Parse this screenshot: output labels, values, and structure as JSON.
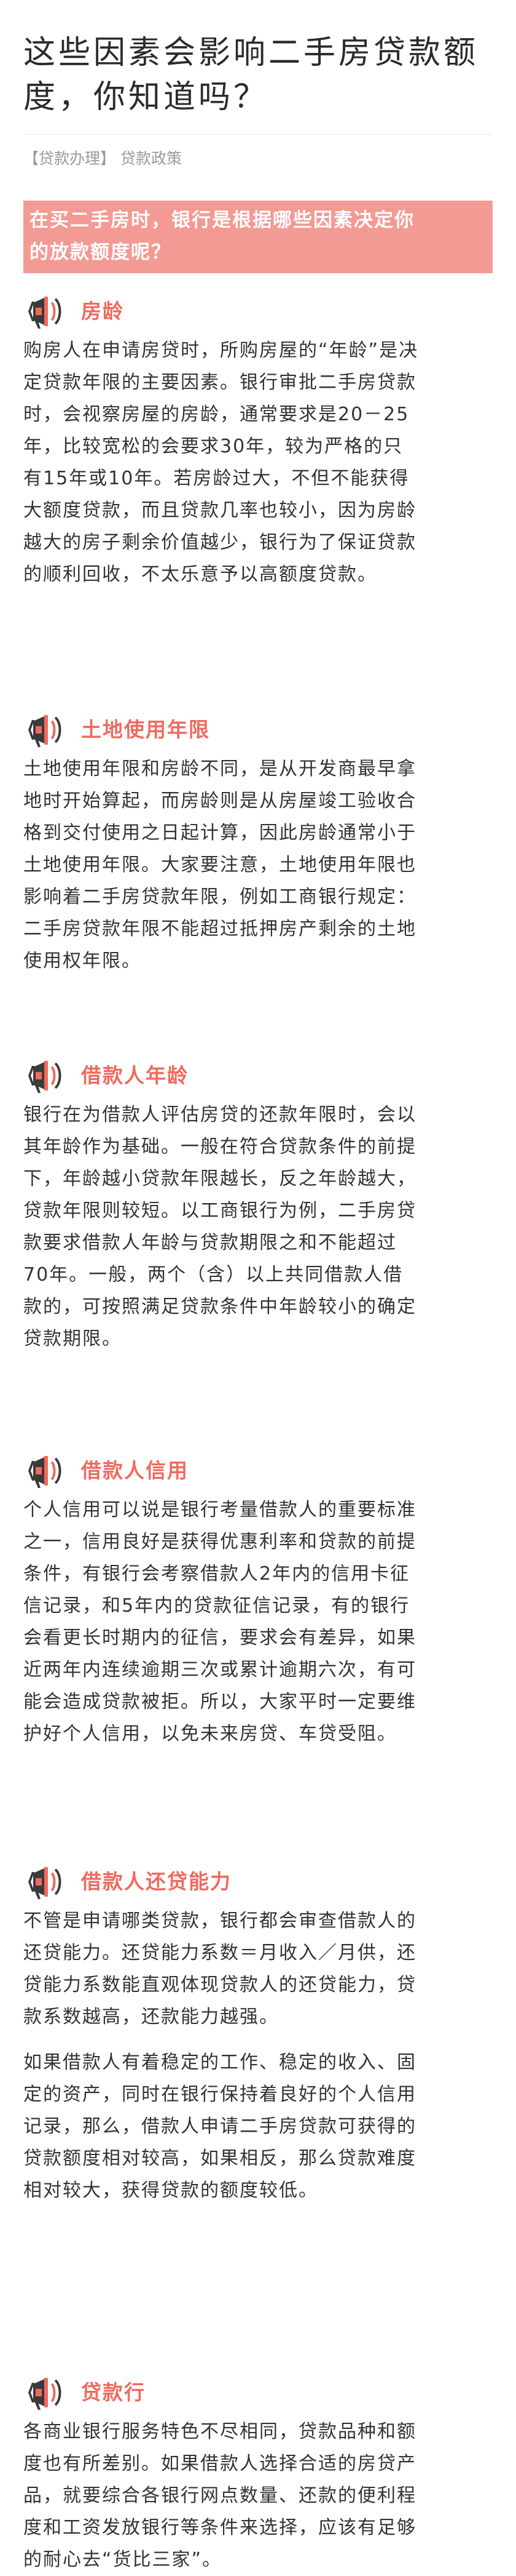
{
  "article": {
    "title_lines": [
      "这些因素会影响二手房贷款额",
      "度，你知道吗？"
    ]
  },
  "breadcrumbs": [
    "【贷款办理】",
    "贷款政策"
  ],
  "banner": {
    "lines": [
      "在买二手房时，银行是根据哪些因素决定你",
      "的放款额度呢？"
    ]
  },
  "colors": {
    "banner_bg": "#f39a94",
    "accent": "#f06a5e",
    "icon_dark": "#3a3a3a"
  },
  "icons": {
    "section_icon": "megaphone-icon"
  },
  "sections": [
    {
      "title": "房龄",
      "paragraphs": [
        [
          "购房人在申请房贷时，所购房屋的“年龄”是决",
          "定贷款年限的主要因素。银行审批二手房贷款",
          "时，会视察房屋的房龄，通常要求是20－25",
          "年，比较宽松的会要求30年，较为严格的只",
          "有15年或10年。若房龄过大，不但不能获得",
          "大额度贷款，而且贷款几率也较小，因为房龄",
          "越大的房子剩余价值越少，银行为了保证贷款",
          "的顺利回收，不太乐意予以高额度贷款。"
        ]
      ]
    },
    {
      "title": "土地使用年限",
      "paragraphs": [
        [
          "土地使用年限和房龄不同，是从开发商最早拿",
          "地时开始算起，而房龄则是从房屋竣工验收合",
          "格到交付使用之日起计算，因此房龄通常小于",
          "土地使用年限。大家要注意，土地使用年限也",
          "影响着二手房贷款年限，例如工商银行规定：",
          "二手房贷款年限不能超过抵押房产剩余的土地",
          "使用权年限。"
        ]
      ]
    },
    {
      "title": "借款人年龄",
      "paragraphs": [
        [
          "银行在为借款人评估房贷的还款年限时，会以",
          "其年龄作为基础。一般在符合贷款条件的前提",
          "下，年龄越小贷款年限越长，反之年龄越大，",
          "贷款年限则较短。以工商银行为例，二手房贷",
          "款要求借款人年龄与贷款期限之和不能超过",
          "70年。一般，两个（含）以上共同借款人借",
          "款的，可按照满足贷款条件中年龄较小的确定",
          "贷款期限。"
        ]
      ]
    },
    {
      "title": "借款人信用",
      "paragraphs": [
        [
          "个人信用可以说是银行考量借款人的重要标准",
          "之一，信用良好是获得优惠利率和贷款的前提",
          "条件，有银行会考察借款人2年内的信用卡征",
          "信记录，和5年内的贷款征信记录，有的银行",
          "会看更长时期内的征信，要求会有差异，如果",
          "近两年内连续逾期三次或累计逾期六次，有可",
          "能会造成贷款被拒。所以，大家平时一定要维",
          "护好个人信用，以免未来房贷、车贷受阻。"
        ]
      ]
    },
    {
      "title": "借款人还贷能力",
      "paragraphs": [
        [
          "不管是申请哪类贷款，银行都会审查借款人的",
          "还贷能力。还贷能力系数＝月收入／月供，还",
          "贷能力系数能直观体现贷款人的还贷能力，贷",
          "款系数越高，还款能力越强。"
        ],
        [
          "如果借款人有着稳定的工作、稳定的收入、固",
          "定的资产，同时在银行保持着良好的个人信用",
          "记录，那么，借款人申请二手房贷款可获得的",
          "贷款额度相对较高，如果相反，那么贷款难度",
          "相对较大，获得贷款的额度较低。"
        ]
      ]
    },
    {
      "title": "贷款行",
      "paragraphs": [
        [
          "各商业银行服务特色不尽相同，贷款品种和额",
          "度也有所差别。如果借款人选择合适的房贷产",
          "品，就要综合各银行网点数量、还款的便利程",
          "度和工资发放银行等条件来选择，应该有足够",
          "的耐心去“货比三家”。"
        ]
      ]
    }
  ]
}
